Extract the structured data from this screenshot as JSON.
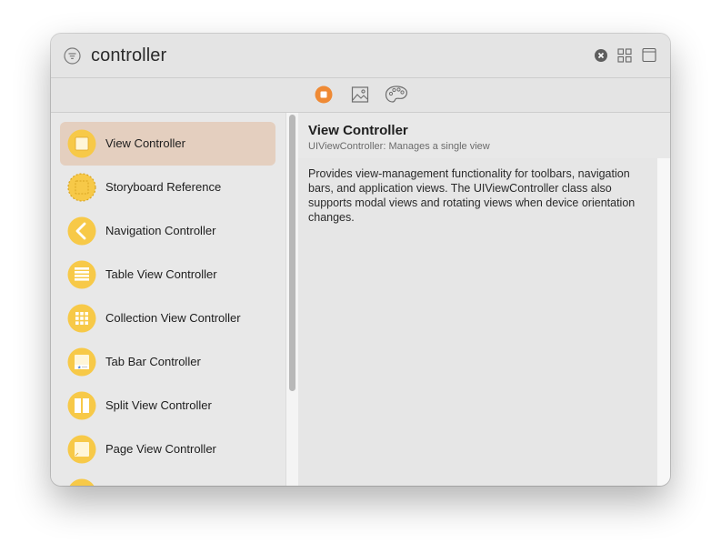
{
  "search": {
    "query": "controller"
  },
  "toolbar": {
    "filter_icon": "filter-icon",
    "clear_icon": "clear-search-icon",
    "grid_icon": "grid-view-icon",
    "layout_icon": "toggle-layout-icon"
  },
  "library_tabs": [
    {
      "icon": "objects-library-icon",
      "selected": true,
      "color": "#ef8a35"
    },
    {
      "icon": "media-library-icon",
      "selected": false
    },
    {
      "icon": "color-library-icon",
      "selected": false
    }
  ],
  "list": {
    "items": [
      {
        "label": "View Controller",
        "icon": "view-controller-icon",
        "selected": true
      },
      {
        "label": "Storyboard Reference",
        "icon": "storyboard-reference-icon"
      },
      {
        "label": "Navigation Controller",
        "icon": "navigation-controller-icon"
      },
      {
        "label": "Table View Controller",
        "icon": "table-view-controller-icon"
      },
      {
        "label": "Collection View Controller",
        "icon": "collection-view-controller-icon"
      },
      {
        "label": "Tab Bar Controller",
        "icon": "tab-bar-controller-icon"
      },
      {
        "label": "Split View Controller",
        "icon": "split-view-controller-icon"
      },
      {
        "label": "Page View Controller",
        "icon": "page-view-controller-icon"
      }
    ]
  },
  "detail": {
    "title": "View Controller",
    "subtitle": "UIViewController: Manages a single view",
    "description": "Provides view-management functionality for toolbars, navigation bars, and application views. The UIViewController class also supports modal views and rotating views when device orientation changes."
  },
  "colors": {
    "icon_yellow": "#f7c948",
    "selection": "#e4cfbf",
    "accent_orange": "#ef8a35"
  }
}
